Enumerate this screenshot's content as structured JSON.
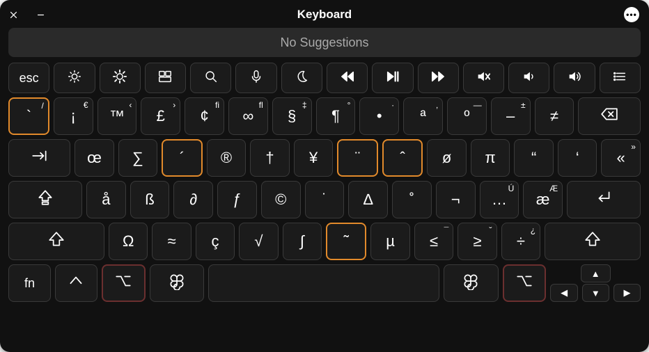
{
  "window": {
    "title": "Keyboard"
  },
  "suggestions": {
    "text": "No Suggestions"
  },
  "fnRow": [
    {
      "name": "esc",
      "label": "esc",
      "icon": null
    },
    {
      "name": "brightness-down",
      "icon": "sun-low"
    },
    {
      "name": "brightness-up",
      "icon": "sun-high"
    },
    {
      "name": "mission-control",
      "icon": "mission"
    },
    {
      "name": "search",
      "icon": "search"
    },
    {
      "name": "dictation",
      "icon": "mic"
    },
    {
      "name": "dnd",
      "icon": "moon"
    },
    {
      "name": "rewind",
      "icon": "rew"
    },
    {
      "name": "play-pause",
      "icon": "playpause"
    },
    {
      "name": "forward",
      "icon": "fwd"
    },
    {
      "name": "mute",
      "icon": "mute"
    },
    {
      "name": "volume-down",
      "icon": "vol-low"
    },
    {
      "name": "volume-up",
      "icon": "vol-high"
    },
    {
      "name": "list",
      "icon": "list"
    }
  ],
  "row1": [
    {
      "name": "grave",
      "label": "`",
      "sup": "/",
      "hl": true,
      "flex": 1
    },
    {
      "name": "exclaim-inv",
      "label": "¡",
      "sup": "€",
      "flex": 1
    },
    {
      "name": "trademark",
      "label": "™",
      "sup": "‹",
      "flex": 1
    },
    {
      "name": "pound",
      "label": "£",
      "sup": "›",
      "flex": 1
    },
    {
      "name": "cent",
      "label": "¢",
      "sup": "fi",
      "flex": 1
    },
    {
      "name": "infinity",
      "label": "∞",
      "sup": "fl",
      "flex": 1
    },
    {
      "name": "section",
      "label": "§",
      "sup": "‡",
      "flex": 1
    },
    {
      "name": "pilcrow",
      "label": "¶",
      "sup": "°",
      "flex": 1
    },
    {
      "name": "bullet",
      "label": "•",
      "sup": "·",
      "flex": 1
    },
    {
      "name": "feminine-ord",
      "label": "ª",
      "sup": "‚",
      "flex": 1
    },
    {
      "name": "masculine-ord",
      "label": "º",
      "sup": "—",
      "flex": 1
    },
    {
      "name": "endash",
      "label": "–",
      "sup": "±",
      "flex": 1
    },
    {
      "name": "not-equal",
      "label": "≠",
      "sup": "",
      "flex": 1
    },
    {
      "name": "backspace",
      "icon": "backspace",
      "flex": 1.6
    }
  ],
  "row2": [
    {
      "name": "tab",
      "icon": "tab",
      "flex": 1.6
    },
    {
      "name": "oe",
      "label": "œ",
      "sup": "",
      "flex": 1
    },
    {
      "name": "sigma",
      "label": "∑",
      "sup": "",
      "flex": 1
    },
    {
      "name": "acute",
      "label": "´",
      "sup": "",
      "hl": true,
      "flex": 1
    },
    {
      "name": "registered",
      "label": "®",
      "sup": "",
      "flex": 1
    },
    {
      "name": "dagger",
      "label": "†",
      "sup": "",
      "flex": 1
    },
    {
      "name": "yen",
      "label": "¥",
      "sup": "",
      "flex": 1
    },
    {
      "name": "diaeresis",
      "label": "¨",
      "sup": "",
      "hl": true,
      "flex": 1
    },
    {
      "name": "circumflex",
      "label": "ˆ",
      "sup": "",
      "hl": true,
      "flex": 1
    },
    {
      "name": "o-slash",
      "label": "ø",
      "sup": "",
      "flex": 1
    },
    {
      "name": "pi",
      "label": "π",
      "sup": "",
      "flex": 1
    },
    {
      "name": "open-ldquo",
      "label": "“",
      "sup": "",
      "flex": 1
    },
    {
      "name": "open-lsquo",
      "label": "‘",
      "sup": "",
      "flex": 1
    },
    {
      "name": "guillemet-left",
      "label": "«",
      "sup": "»",
      "flex": 1
    }
  ],
  "row3": [
    {
      "name": "caps-lock",
      "icon": "caps",
      "flex": 1.9
    },
    {
      "name": "a-ring",
      "label": "å",
      "sup": "",
      "flex": 1
    },
    {
      "name": "eszett",
      "label": "ß",
      "sup": "",
      "flex": 1
    },
    {
      "name": "partial",
      "label": "∂",
      "sup": "",
      "flex": 1
    },
    {
      "name": "florin",
      "label": "ƒ",
      "sup": "",
      "flex": 1
    },
    {
      "name": "copyright",
      "label": "©",
      "sup": "",
      "flex": 1
    },
    {
      "name": "dot-above",
      "label": "˙",
      "sup": "",
      "flex": 1
    },
    {
      "name": "delta",
      "label": "∆",
      "sup": "",
      "flex": 1
    },
    {
      "name": "ring-above",
      "label": "˚",
      "sup": "",
      "flex": 1
    },
    {
      "name": "not-sign",
      "label": "¬",
      "sup": "",
      "flex": 1
    },
    {
      "name": "ellipsis",
      "label": "…",
      "sup": "Ú",
      "flex": 1
    },
    {
      "name": "ae",
      "label": "æ",
      "sup": "Æ",
      "flex": 1
    },
    {
      "name": "return",
      "icon": "return",
      "flex": 1.9
    }
  ],
  "row4": [
    {
      "name": "shift-left",
      "icon": "shift",
      "flex": 2.5
    },
    {
      "name": "omega",
      "label": "Ω",
      "sup": "",
      "flex": 1
    },
    {
      "name": "approx",
      "label": "≈",
      "sup": "",
      "flex": 1
    },
    {
      "name": "c-cedilla",
      "label": "ç",
      "sup": "",
      "flex": 1
    },
    {
      "name": "sqrt",
      "label": "√",
      "sup": "",
      "flex": 1
    },
    {
      "name": "integral",
      "label": "∫",
      "sup": "",
      "flex": 1
    },
    {
      "name": "tilde",
      "label": "˜",
      "sup": "",
      "hl": true,
      "flex": 1
    },
    {
      "name": "mu",
      "label": "µ",
      "sup": "",
      "flex": 1
    },
    {
      "name": "le",
      "label": "≤",
      "sup": "¯",
      "flex": 1
    },
    {
      "name": "ge",
      "label": "≥",
      "sup": "˘",
      "flex": 1
    },
    {
      "name": "division",
      "label": "÷",
      "sup": "¿",
      "flex": 1
    },
    {
      "name": "shift-right",
      "icon": "shift",
      "flex": 2.5
    }
  ],
  "row5": [
    {
      "name": "fn",
      "label": "fn",
      "flex": 1
    },
    {
      "name": "control",
      "icon": "ctrl",
      "flex": 1
    },
    {
      "name": "option-left",
      "icon": "option",
      "hlred": true,
      "flex": 1
    },
    {
      "name": "command-left",
      "icon": "cmd",
      "flex": 1.3
    },
    {
      "name": "spacebar",
      "label": "",
      "flex": 5.6
    },
    {
      "name": "command-right",
      "icon": "cmd",
      "flex": 1.3
    },
    {
      "name": "option-right",
      "icon": "option",
      "hlred": true,
      "flex": 1
    }
  ],
  "arrows": {
    "up": "▲",
    "left": "◀",
    "down": "▼",
    "right": "▶"
  }
}
